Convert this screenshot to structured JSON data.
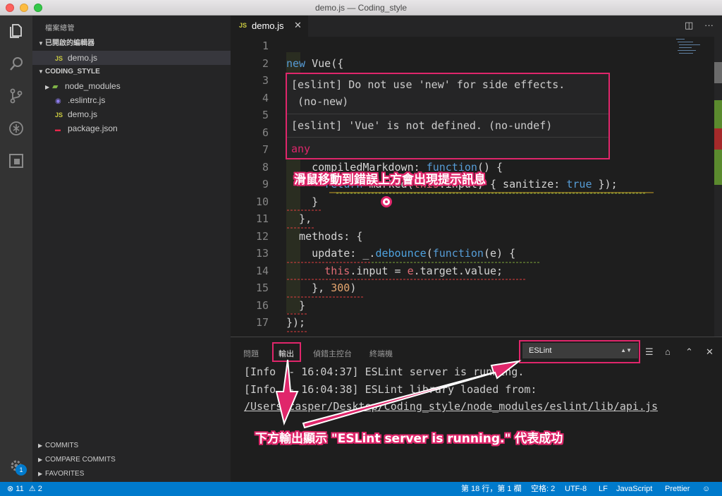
{
  "window": {
    "title": "demo.js — Coding_style"
  },
  "sidebar": {
    "title": "檔案總管",
    "open_editors": {
      "label": "已開啟的編輯器",
      "files": [
        {
          "name": "demo.js",
          "icon": "JS"
        }
      ]
    },
    "project": {
      "label": "CODING_STYLE",
      "items": [
        {
          "name": "node_modules",
          "kind": "folder"
        },
        {
          "name": ".eslintrc.js",
          "kind": "eslint"
        },
        {
          "name": "demo.js",
          "kind": "js",
          "icon": "JS"
        },
        {
          "name": "package.json",
          "kind": "npm"
        }
      ]
    },
    "bottom_sections": [
      {
        "label": "COMMITS"
      },
      {
        "label": "COMPARE COMMITS"
      },
      {
        "label": "FAVORITES"
      }
    ],
    "settings_badge": "1"
  },
  "tabs": [
    {
      "label": "demo.js",
      "icon": "JS",
      "active": true
    }
  ],
  "editor": {
    "line_numbers": [
      "1",
      "2",
      "3",
      "4",
      "5",
      "6",
      "7",
      "8",
      "9",
      "10",
      "11",
      "12",
      "13",
      "14",
      "15",
      "16",
      "17"
    ],
    "hover": {
      "msg1_line1": "[eslint] Do not use 'new' for side effects.",
      "msg1_line2": " (no-new)",
      "msg2": "[eslint] 'Vue' is not defined. (no-undef)",
      "type": "any"
    },
    "code": {
      "l2_new": "new",
      "l2_rest": " Vue({",
      "l8_a": "    compiledMarkdown: ",
      "l8_fn": "function",
      "l8_b": "() {",
      "l9_return": "return",
      "l9_a": " marked(",
      "l9_this": "this",
      "l9_b": ".input, { sanitize: ",
      "l9_true": "true",
      "l9_c": " });",
      "l10": "    }",
      "l11": "  },",
      "l12": "  methods: {",
      "l13_a": "    update: _.",
      "l13_fn": "debounce",
      "l13_b": "(",
      "l13_kw": "function",
      "l13_c": "(e) {",
      "l14_this": "this",
      "l14_a": ".input = ",
      "l14_e": "e",
      "l14_b": ".target.value;",
      "l15_a": "    }, ",
      "l15_num": "300",
      "l15_b": ")",
      "l16": "  }",
      "l17": "});"
    }
  },
  "panel": {
    "tabs": [
      {
        "label": "問題"
      },
      {
        "label": "輸出",
        "active": true
      },
      {
        "label": "偵錯主控台"
      },
      {
        "label": "終端機"
      }
    ],
    "channel": "ESLint",
    "output": [
      "[Info  - 16:04:37] ESLint server is running.",
      "[Info  - 16:04:38] ESLint library loaded from:",
      "/Users/casper/Desktop/Coding_style/node_modules/eslint/lib/api.js"
    ]
  },
  "annotations": {
    "hover_note": "滑鼠移動到錯誤上方會出現提示訊息",
    "output_note": "下方輸出顯示 \"ESLint server is running.\" 代表成功"
  },
  "statusbar": {
    "errors": "11",
    "warnings": "2",
    "position": "第 18 行，第 1 欄",
    "spaces": "空格: 2",
    "encoding": "UTF-8",
    "eol": "LF",
    "language": "JavaScript",
    "formatter": "Prettier"
  },
  "colors": {
    "accent": "#e0266b",
    "status": "#007acc"
  }
}
